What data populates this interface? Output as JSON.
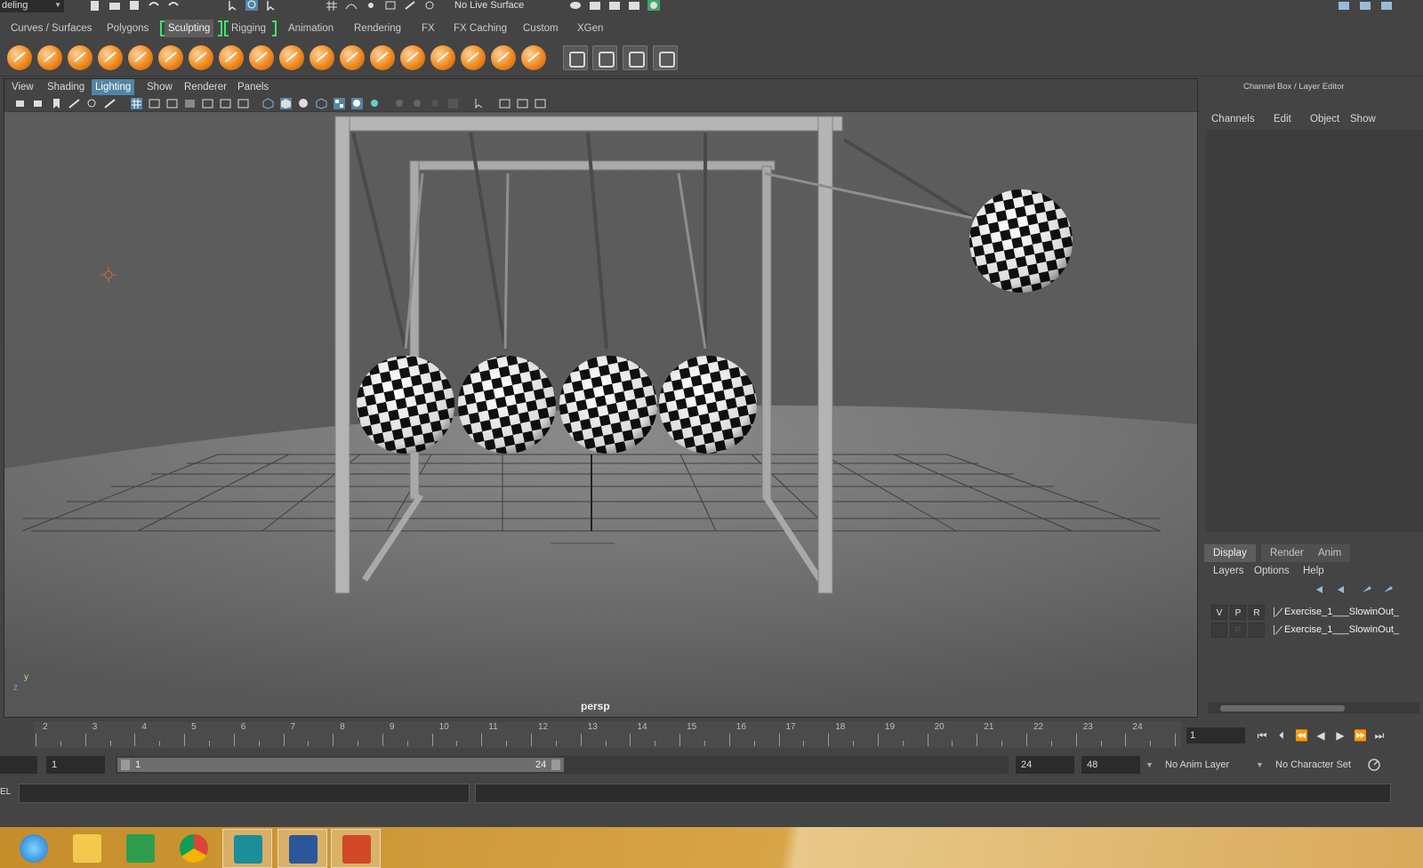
{
  "top": {
    "mode_select": "deling",
    "live_surface": "No Live Surface"
  },
  "shelf_tabs": [
    "Curves / Surfaces",
    "Polygons",
    "Sculpting",
    "Rigging",
    "Animation",
    "Rendering",
    "FX",
    "FX Caching",
    "Custom",
    "XGen"
  ],
  "shelf_active_tab": "Sculpting",
  "viewport": {
    "menu": [
      "View",
      "Shading",
      "Lighting",
      "Show",
      "Renderer",
      "Panels"
    ],
    "active_menu": "Lighting",
    "camera_label": "persp",
    "axis_y": "y",
    "axis_z": "z"
  },
  "channel_box": {
    "title": "Channel Box / Layer Editor",
    "menu": [
      "Channels",
      "Edit",
      "Object",
      "Show"
    ],
    "layer_tabs": [
      "Display",
      "Render",
      "Anim"
    ],
    "active_layer_tab": "Display",
    "layer_menu": [
      "Layers",
      "Options",
      "Help"
    ],
    "layers": [
      {
        "v": "V",
        "p": "P",
        "r": "R",
        "name": "Exercise_1___SlowinOut_"
      },
      {
        "v": "",
        "p": "P",
        "r": "",
        "name": "Exercise_1___SlowinOut_"
      }
    ]
  },
  "timeline": {
    "tick_labels": [
      "2",
      "3",
      "4",
      "5",
      "6",
      "7",
      "8",
      "9",
      "10",
      "11",
      "12",
      "13",
      "14",
      "15",
      "16",
      "17",
      "18",
      "19",
      "20",
      "21",
      "22",
      "23",
      "24"
    ],
    "current_frame": "1"
  },
  "range": {
    "start": "1",
    "range_start": "1",
    "range_end": "24",
    "end": "24",
    "anim_end": "48",
    "anim_layer": "No Anim Layer",
    "character_set": "No Character Set"
  },
  "command_line": {
    "label": "EL"
  },
  "taskbar": {
    "apps": [
      "internet-explorer",
      "file-explorer",
      "store",
      "chrome",
      "maya",
      "word",
      "powerpoint"
    ]
  },
  "colors": {
    "accent": "#5285a6",
    "shelf_bracket": "#3fe36b",
    "panel": "#444444",
    "viewport_bg": "#5a5a5a"
  }
}
